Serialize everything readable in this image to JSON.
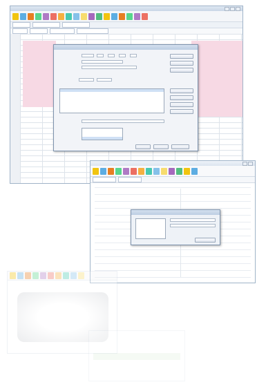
{
  "colors": {
    "window_border": "#9fb3c8",
    "pink_fill": "#f7d9e4",
    "dialog_bg": "#f2f4f8",
    "selection": "#cfe0f5",
    "green_bar": "#d6ead0"
  },
  "icons": [
    "calendar-icon",
    "table-icon",
    "edit-icon",
    "print-icon",
    "preview-icon",
    "person-icon",
    "tag-icon",
    "grid-icon",
    "chart-icon",
    "settings-icon",
    "book-icon",
    "save-icon"
  ]
}
